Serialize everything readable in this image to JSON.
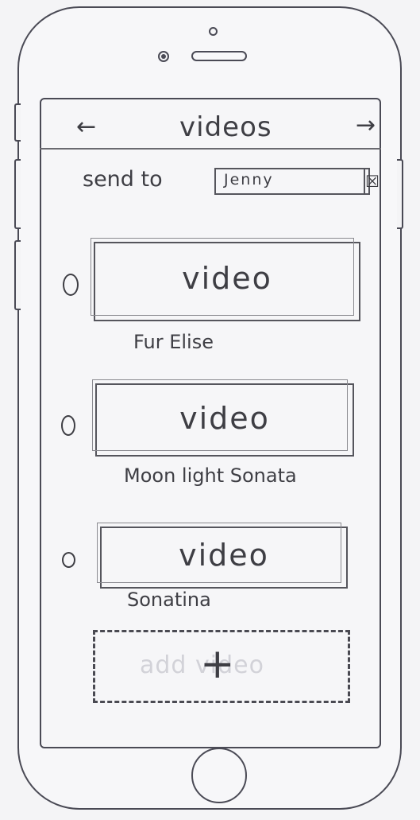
{
  "header": {
    "back_arrow": "←",
    "title": "videos",
    "forward_arrow": "→"
  },
  "send": {
    "label": "send to",
    "recipient": "Jenny",
    "dropdown_icon": "☒"
  },
  "videos": [
    {
      "label": "video",
      "title": "Fur Elise"
    },
    {
      "label": "video",
      "title": "Moon light Sonata"
    },
    {
      "label": "video",
      "title": "Sonatina"
    }
  ],
  "add": {
    "ghost_label": "add video",
    "plus": "+"
  },
  "icons": {
    "back": "arrow-left-icon",
    "forward": "arrow-right-icon",
    "dropdown": "checkbox-x-icon",
    "add": "plus-icon"
  }
}
